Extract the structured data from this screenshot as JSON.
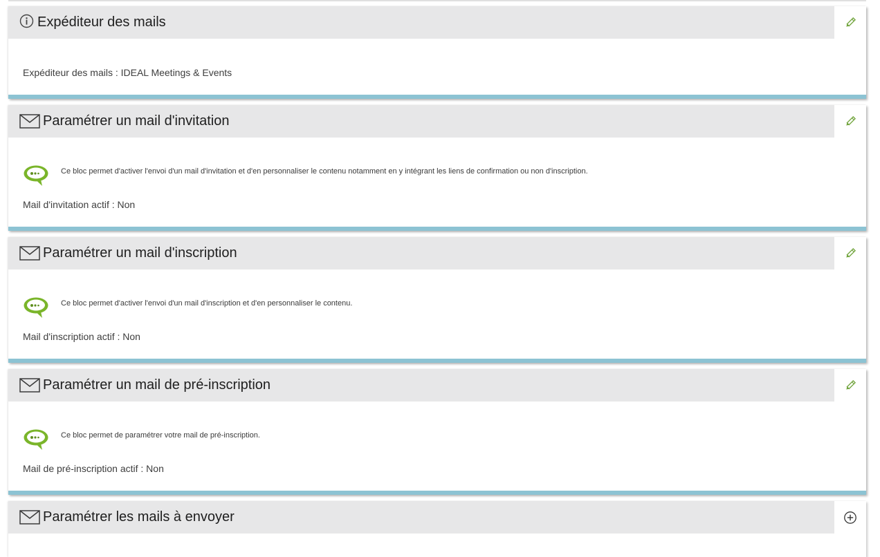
{
  "colors": {
    "header_bg": "#e7e7e8",
    "accent_bar": "#8cc3d3",
    "edit_icon": "#6fa33a",
    "chat_icon": "#7ab52a"
  },
  "sections": [
    {
      "title": "Expéditeur des mails",
      "icon": "info-icon",
      "action": "edit-pencil-icon",
      "status": "Expéditeur des mails : IDEAL Meetings & Events"
    },
    {
      "title": "Paramétrer un mail d'invitation",
      "icon": "envelope-icon",
      "action": "edit-pencil-icon",
      "hint": "Ce bloc permet d'activer l'envoi d'un mail d'invitation et d'en personnaliser le contenu notamment en y intégrant les liens de confirmation ou non d'inscription.",
      "status": "Mail d'invitation actif : Non"
    },
    {
      "title": "Paramétrer un mail d'inscription",
      "icon": "envelope-icon",
      "action": "edit-pencil-icon",
      "hint": "Ce bloc permet d'activer l'envoi d'un mail d'inscription et d'en personnaliser le contenu.",
      "status": "Mail d'inscription actif : Non"
    },
    {
      "title": "Paramétrer un mail de pré-inscription",
      "icon": "envelope-icon",
      "action": "edit-pencil-icon",
      "hint": "Ce bloc permet de paramétrer votre mail de pré-inscription.",
      "status": "Mail de pré-inscription actif : Non"
    },
    {
      "title": "Paramétrer les mails à envoyer",
      "icon": "envelope-icon",
      "action": "expand-plus-icon"
    }
  ]
}
